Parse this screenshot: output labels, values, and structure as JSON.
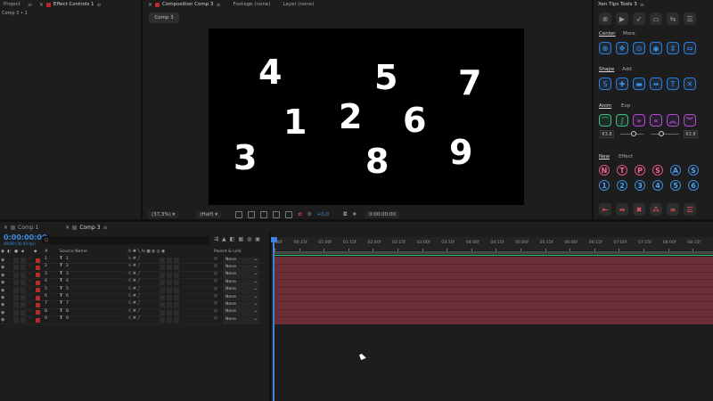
{
  "project_panel": {
    "tab_project": "Project",
    "tab_effect_controls": "Effect Controls 1",
    "breadcrumb": "Comp 3 • 1"
  },
  "comp_panel": {
    "tab_composition": "Composition Comp 3",
    "tab_footage": "Footage (none)",
    "tab_layer": "Layer (none)",
    "comp_pill": "Comp 3",
    "digits": [
      "4",
      "5",
      "7",
      "1",
      "2",
      "6",
      "3",
      "8",
      "9"
    ],
    "zoom": "(37,3%)",
    "resolution": "(Half)",
    "exposure": "+0,0",
    "timecode": "0:00:00:00"
  },
  "tools_panel": {
    "title": "Xen Tips Tools 3",
    "tab_center": "Center",
    "tab_more": "More",
    "tab_shape": "Shape",
    "tab_add": "Add",
    "tab_anim": "Anim",
    "tab_exp": "Exp",
    "value_left": "63.8",
    "value_right": "63.8",
    "tab_new": "New",
    "tab_effect": "Effect",
    "letters": [
      "N",
      "T",
      "P",
      "S",
      "A",
      "S"
    ],
    "numbers": [
      "1",
      "2",
      "3",
      "4",
      "5",
      "6"
    ]
  },
  "timeline": {
    "tab_comp1": "Comp 1",
    "tab_comp3": "Comp 3",
    "timecode": "0:00:00:00",
    "fps": "00000 (30.00 fps)",
    "search_placeholder": "Q.",
    "col_hash": "#",
    "col_source": "Source Name",
    "col_parent": "Parent & Link",
    "ruler": [
      "00f",
      "00:15f",
      "01:00f",
      "01:15f",
      "02:00f",
      "02:15f",
      "03:00f",
      "03:15f",
      "04:00f",
      "04:15f",
      "05:00f",
      "05:15f",
      "06:00f",
      "06:15f",
      "07:00f",
      "07:15f",
      "08:00f",
      "08:15f"
    ],
    "layers": [
      {
        "num": "1",
        "name": "1",
        "parent": "None"
      },
      {
        "num": "2",
        "name": "2",
        "parent": "None"
      },
      {
        "num": "3",
        "name": "3",
        "parent": "None"
      },
      {
        "num": "4",
        "name": "4",
        "parent": "None"
      },
      {
        "num": "5",
        "name": "5",
        "parent": "None"
      },
      {
        "num": "6",
        "name": "6",
        "parent": "None"
      },
      {
        "num": "7",
        "name": "7",
        "parent": "None"
      },
      {
        "num": "8",
        "name": "8",
        "parent": "None"
      },
      {
        "num": "9",
        "name": "9",
        "parent": "None"
      }
    ]
  },
  "colors": {
    "accent": "#3d8de0",
    "track": "#6b2f39",
    "label_red": "#b8282f",
    "work_green": "#35c76f"
  }
}
